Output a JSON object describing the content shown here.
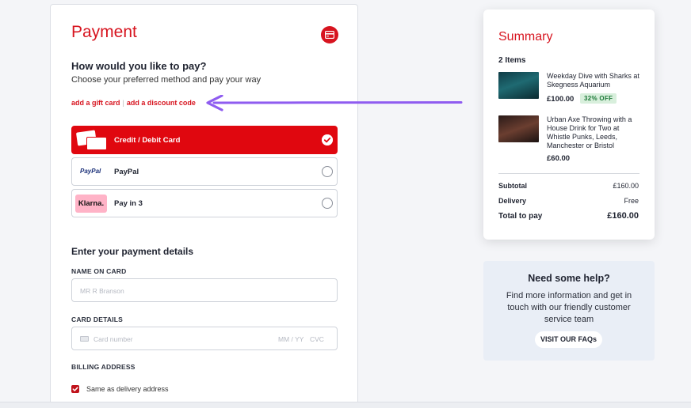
{
  "payment": {
    "title": "Payment",
    "question": "How would you like to pay?",
    "subtitle": "Choose your preferred method and pay your way",
    "gift_card_link": "add a gift card",
    "discount_link": "add a discount code",
    "options": [
      {
        "label": "Credit / Debit Card",
        "selected": true
      },
      {
        "label": "PayPal",
        "selected": false,
        "logo_text": "PayPal"
      },
      {
        "label": "Pay in 3",
        "selected": false,
        "logo_text": "Klarna."
      }
    ],
    "details_heading": "Enter your payment details",
    "name_label": "NAME ON CARD",
    "name_placeholder": "MR R Branson",
    "card_label": "CARD DETAILS",
    "card_placeholder": "Card number",
    "expiry_placeholder": "MM / YY",
    "cvc_placeholder": "CVC",
    "billing_label": "BILLING ADDRESS",
    "same_address_label": "Same as delivery address"
  },
  "summary": {
    "title": "Summary",
    "item_count": "2 Items",
    "items": [
      {
        "name": "Weekday Dive with Sharks at Skegness Aquarium",
        "price": "£100.00",
        "badge": "32% OFF"
      },
      {
        "name": "Urban Axe Throwing with a House Drink for Two at Whistle Punks, Leeds, Manchester or Bristol",
        "price": "£60.00"
      }
    ],
    "subtotal_label": "Subtotal",
    "subtotal_value": "£160.00",
    "delivery_label": "Delivery",
    "delivery_value": "Free",
    "total_label": "Total to pay",
    "total_value": "£160.00"
  },
  "help": {
    "title": "Need some help?",
    "text": "Find more information and get in touch with our friendly customer service team",
    "button": "VISIT OUR FAQs"
  },
  "colors": {
    "brand_red": "#d7141f",
    "selected_red": "#e0070f",
    "arrow_purple": "#8f5cf0",
    "discount_green": "#1f7a3a"
  }
}
